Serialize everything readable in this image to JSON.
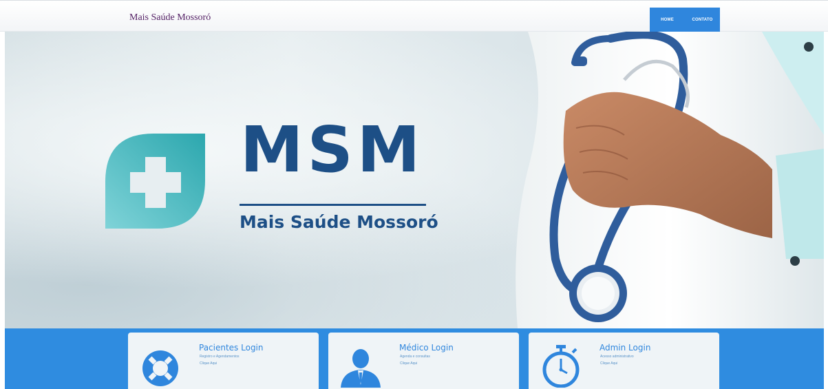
{
  "header": {
    "brand": "Mais Saúde Mossoró",
    "nav": [
      {
        "label": "HOME"
      },
      {
        "label": "CONTATO"
      }
    ],
    "nav_color": "#2f86dd"
  },
  "hero": {
    "logo_title": "MSM",
    "logo_subtitle": "Mais Saúde Mossoró",
    "logo_color": "#1d4f86",
    "mark_gradient": [
      "#7fd3d8",
      "#2ca7ae"
    ]
  },
  "cards": [
    {
      "title": "Pacientes Login",
      "description": "Registro e Agendamentos",
      "link": "Clique Aqui",
      "icon": "lifebuoy-icon"
    },
    {
      "title": "Médico Login",
      "description": "Agenda e consultas",
      "link": "Clique Aqui",
      "icon": "doctor-icon"
    },
    {
      "title": "Admin Login",
      "description": "Acesso administrativo",
      "link": "Clique Aqui",
      "icon": "stopwatch-icon"
    }
  ],
  "band_color": "#2f8ce0"
}
